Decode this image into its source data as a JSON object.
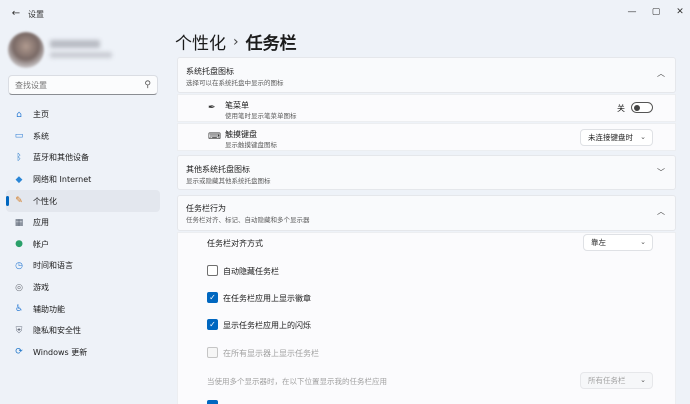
{
  "window": {
    "title": "设置",
    "back": "←",
    "minimize": "—",
    "maximize": "▢",
    "close": "✕"
  },
  "search": {
    "placeholder": "查找设置"
  },
  "sidebar": {
    "items": [
      {
        "label": "主页",
        "icon": "⌂",
        "color": "#2a7bd4"
      },
      {
        "label": "系统",
        "icon": "▭",
        "color": "#2a7bd4"
      },
      {
        "label": "蓝牙和其他设备",
        "icon": "ᛒ",
        "color": "#1a73c8"
      },
      {
        "label": "网络和 Internet",
        "icon": "◆",
        "color": "#2a86d6"
      },
      {
        "label": "个性化",
        "icon": "✎",
        "color": "#d4781c"
      },
      {
        "label": "应用",
        "icon": "▦",
        "color": "#555f6e"
      },
      {
        "label": "帐户",
        "icon": "●",
        "color": "#2aa06a"
      },
      {
        "label": "时间和语言",
        "icon": "◷",
        "color": "#2a7bd4"
      },
      {
        "label": "游戏",
        "icon": "◎",
        "color": "#6b6f77"
      },
      {
        "label": "辅助功能",
        "icon": "♿",
        "color": "#2a7bd4"
      },
      {
        "label": "隐私和安全性",
        "icon": "⛨",
        "color": "#6b7280"
      },
      {
        "label": "Windows 更新",
        "icon": "⟳",
        "color": "#1a73c8"
      }
    ],
    "active_index": 4
  },
  "breadcrumb": {
    "parent": "个性化",
    "separator": "›",
    "current": "任务栏"
  },
  "tray_icons": {
    "title": "系统托盘图标",
    "subtitle": "选择可以在系统托盘中显示的图标",
    "items": [
      {
        "icon": "✒",
        "title": "笔菜单",
        "subtitle": "使用笔时显示笔菜单图标",
        "control": "toggle",
        "state_label": "关"
      },
      {
        "icon": "⌨",
        "title": "触摸键盘",
        "subtitle": "显示触摸键盘图标",
        "control": "dropdown",
        "value": "未连接键盘时"
      }
    ]
  },
  "other_tray": {
    "title": "其他系统托盘图标",
    "subtitle": "显示或隐藏其他系统托盘图标"
  },
  "behaviors": {
    "title": "任务栏行为",
    "subtitle": "任务栏对齐、标记、自动隐藏和多个显示器",
    "alignment_label": "任务栏对齐方式",
    "alignment_value": "靠左",
    "checkboxes": [
      {
        "label": "自动隐藏任务栏",
        "checked": false,
        "disabled": false
      },
      {
        "label": "在任务栏应用上显示徽章",
        "checked": true,
        "disabled": false
      },
      {
        "label": "显示任务栏应用上的闪烁",
        "checked": true,
        "disabled": false
      },
      {
        "label": "在所有显示器上显示任务栏",
        "checked": false,
        "disabled": true
      }
    ],
    "multi_display_label": "当使用多个显示器时，在以下位置显示我的任务栏应用",
    "multi_display_value": "所有任务栏"
  },
  "icons": {
    "chevron_up": "︿",
    "chevron_down": "﹀",
    "dropdown_chevron": "⌄",
    "check": "✓",
    "search": "⚲"
  },
  "colors": {
    "accent": "#0067c0",
    "background": "#eef2f8",
    "card": "#f9fafc"
  }
}
